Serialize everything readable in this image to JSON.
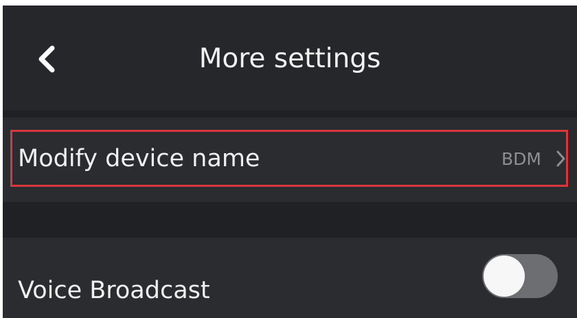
{
  "header": {
    "title": "More settings",
    "back_icon": "chevron-left-icon"
  },
  "settings": {
    "device_name": {
      "label": "Modify device name",
      "value": "BDM",
      "icon": "chevron-right-icon"
    },
    "voice_broadcast": {
      "label": "Voice Broadcast",
      "enabled": false
    }
  },
  "colors": {
    "background": "#1f2125",
    "row": "#2a2c30",
    "highlight": "#d9363e",
    "toggle_off": "#6c6e72"
  }
}
